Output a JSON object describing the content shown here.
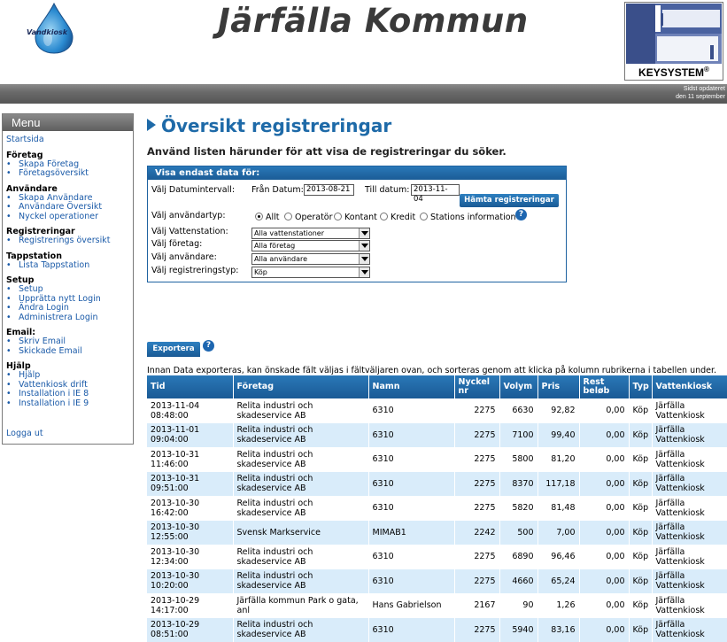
{
  "header": {
    "logo_text": "Vandkiosk",
    "site_title": "Järfälla Kommun",
    "partner_logo_text": "KEYSYSTEM",
    "partner_logo_reg": "®",
    "updated_line1": "Sidst opdateret",
    "updated_line2": "den 11 september"
  },
  "menu": {
    "title": "Menu",
    "start": "Startsida",
    "sections": [
      {
        "title": "Företag",
        "items": [
          "Skapa Företag",
          "Företagsöversikt"
        ]
      },
      {
        "title": "Användare",
        "items": [
          "Skapa Användare",
          "Användare Översikt",
          "Nyckel operationer"
        ]
      },
      {
        "title": "Registreringar",
        "items": [
          "Registrerings översikt"
        ]
      },
      {
        "title": "Tappstation",
        "items": [
          "Lista Tappstation"
        ]
      },
      {
        "title": "Setup",
        "items": [
          "Setup",
          "Upprätta nytt Login",
          "Ändra Login",
          "Administrera Login"
        ]
      },
      {
        "title": "Email:",
        "items": [
          "Skriv Email",
          "Skickade Email"
        ]
      },
      {
        "title": "Hjälp",
        "items": [
          "Hjälp",
          "Vattenkiosk drift",
          "Installation i IE 8",
          "Installation i IE 9"
        ]
      }
    ],
    "logout": "Logga ut"
  },
  "main": {
    "title": "Översikt registreringar",
    "subtitle": "Använd listen härunder för att visa de registreringar du söker."
  },
  "filter": {
    "header": "Visa endast data för:",
    "date_interval_label": "Välj Datumintervall:",
    "from_label": "Från Datum:",
    "from_value": "2013-08-21",
    "to_label": "Till datum:",
    "to_value": "2013-11-04",
    "fetch_button": "Hämta registreringar",
    "user_type_label": "Välj användartyp:",
    "user_types": [
      "Allt",
      "Operatör",
      "Kontant",
      "Kredit",
      "Stations information"
    ],
    "user_type_selected": "Allt",
    "water_station_label": "Välj Vattenstation:",
    "water_station_value": "Alla vattenstationer",
    "company_label": "Välj företag:",
    "company_value": "Alla företag",
    "user_label": "Välj användare:",
    "user_value": "Alla användare",
    "reg_type_label": "Välj registreringstyp:",
    "reg_type_value": "Köp",
    "help_icon": "?"
  },
  "export": {
    "button": "Exportera",
    "help_icon": "?",
    "note": "Innan Data exporteras, kan önskade fält väljas i fältväljaren ovan, och sorteras genom att klicka på kolumn rubrikerna i tabellen under."
  },
  "table": {
    "columns": [
      "Tid",
      "Företag",
      "Namn",
      "Nyckel nr",
      "Volym",
      "Pris",
      "Rest beløb",
      "Typ",
      "Vattenkiosk"
    ],
    "rows": [
      [
        "2013-11-04 08:48:00",
        "Relita industri och skadeservice AB",
        "6310",
        "2275",
        "6630",
        "92,82",
        "0,00",
        "Köp",
        "Järfälla Vattenkiosk"
      ],
      [
        "2013-11-01 09:04:00",
        "Relita industri och skadeservice AB",
        "6310",
        "2275",
        "7100",
        "99,40",
        "0,00",
        "Köp",
        "Järfälla Vattenkiosk"
      ],
      [
        "2013-10-31 11:46:00",
        "Relita industri och skadeservice AB",
        "6310",
        "2275",
        "5800",
        "81,20",
        "0,00",
        "Köp",
        "Järfälla Vattenkiosk"
      ],
      [
        "2013-10-31 09:51:00",
        "Relita industri och skadeservice AB",
        "6310",
        "2275",
        "8370",
        "117,18",
        "0,00",
        "Köp",
        "Järfälla Vattenkiosk"
      ],
      [
        "2013-10-30 16:42:00",
        "Relita industri och skadeservice AB",
        "6310",
        "2275",
        "5820",
        "81,48",
        "0,00",
        "Köp",
        "Järfälla Vattenkiosk"
      ],
      [
        "2013-10-30 12:55:00",
        "Svensk Markservice",
        "MIMAB1",
        "2242",
        "500",
        "7,00",
        "0,00",
        "Köp",
        "Järfälla Vattenkiosk"
      ],
      [
        "2013-10-30 12:34:00",
        "Relita industri och skadeservice AB",
        "6310",
        "2275",
        "6890",
        "96,46",
        "0,00",
        "Köp",
        "Järfälla Vattenkiosk"
      ],
      [
        "2013-10-30 10:20:00",
        "Relita industri och skadeservice AB",
        "6310",
        "2275",
        "4660",
        "65,24",
        "0,00",
        "Köp",
        "Järfälla Vattenkiosk"
      ],
      [
        "2013-10-29 14:17:00",
        "Järfälla kommun Park o gata, anl",
        "Hans Gabrielson",
        "2167",
        "90",
        "1,26",
        "0,00",
        "Köp",
        "Järfälla Vattenkiosk"
      ],
      [
        "2013-10-29 08:51:00",
        "Relita industri och skadeservice AB",
        "6310",
        "2275",
        "5940",
        "83,16",
        "0,00",
        "Köp",
        "Järfälla Vattenkiosk"
      ]
    ]
  }
}
